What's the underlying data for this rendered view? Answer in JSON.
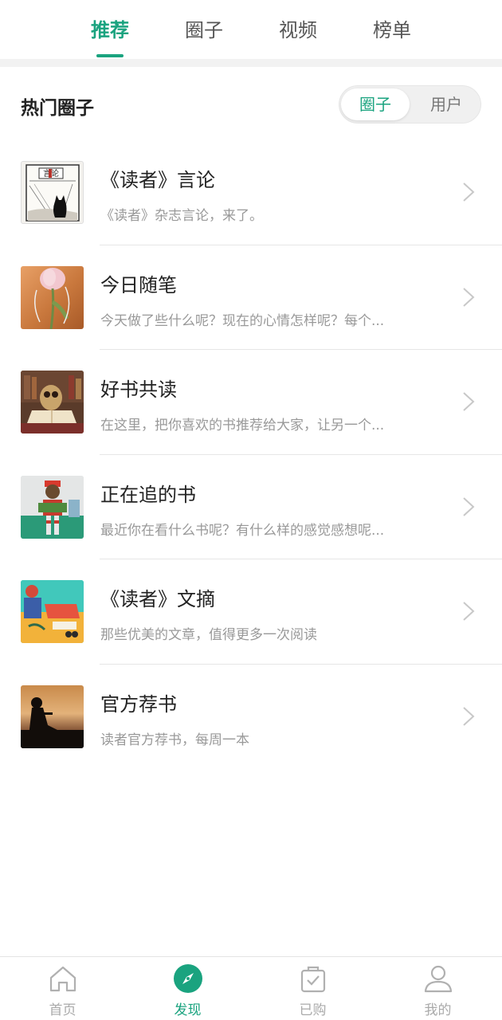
{
  "top_tabs": [
    {
      "label": "推荐",
      "active": true
    },
    {
      "label": "圈子",
      "active": false
    },
    {
      "label": "视频",
      "active": false
    },
    {
      "label": "榜单",
      "active": false
    }
  ],
  "section": {
    "title": "热门圈子",
    "toggle": {
      "selected": "圈子",
      "other": "用户"
    }
  },
  "circles": [
    {
      "title": "《读者》言论",
      "desc": "《读者》杂志言论，来了。",
      "thumb_icon": "ink-sketch-cat-thumbnail",
      "thumb_text": "言论"
    },
    {
      "title": "今日随笔",
      "desc": "今天做了些什么呢？现在的心情怎样呢？每个...",
      "thumb_icon": "tulip-earphones-thumbnail"
    },
    {
      "title": "好书共读",
      "desc": "在这里，把你喜欢的书推荐给大家，让另一个...",
      "thumb_icon": "reading-owl-thumbnail"
    },
    {
      "title": "正在追的书",
      "desc": "最近你在看什么书呢？有什么样的感觉感想呢...",
      "thumb_icon": "toy-figure-reading-thumbnail"
    },
    {
      "title": "《读者》文摘",
      "desc": "那些优美的文章，值得更多一次阅读",
      "thumb_icon": "illustrated-reader-thumbnail"
    },
    {
      "title": "官方荐书",
      "desc": "读者官方荐书，每周一本",
      "thumb_icon": "sunset-silhouette-reader-thumbnail"
    }
  ],
  "bottom_nav": [
    {
      "label": "首页",
      "icon": "home-icon",
      "active": false
    },
    {
      "label": "发现",
      "icon": "compass-icon",
      "active": true
    },
    {
      "label": "已购",
      "icon": "purchased-bag-icon",
      "active": false
    },
    {
      "label": "我的",
      "icon": "profile-icon",
      "active": false
    }
  ],
  "colors": {
    "accent": "#1aa37f",
    "muted": "#999999",
    "divider": "#e6e6e6"
  }
}
